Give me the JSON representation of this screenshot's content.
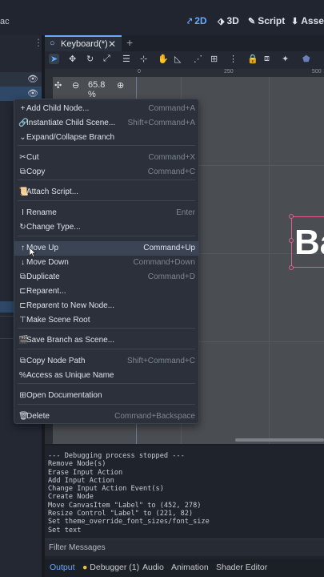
{
  "topbar": {
    "app_fragment": "ac",
    "workspaces": [
      {
        "icon": "2d-icon",
        "label": "2D",
        "active": true
      },
      {
        "icon": "3d-icon",
        "label": "3D",
        "active": false
      },
      {
        "icon": "script-icon",
        "label": "Script",
        "active": false
      },
      {
        "icon": "asset-icon",
        "label": "Asset",
        "active": false
      }
    ]
  },
  "editor": {
    "tab_label": "Keyboard(*)",
    "zoom": "65.8 %",
    "ruler_numbers": [
      "0",
      "250",
      "500"
    ]
  },
  "canvas": {
    "label_text": "Ba"
  },
  "context_menu": {
    "items": [
      {
        "icon": "add-child-icon",
        "glyph": "+",
        "label": "Add Child Node...",
        "shortcut": "Command+A"
      },
      {
        "icon": "link-icon",
        "glyph": "🔗",
        "label": "Instantiate Child Scene...",
        "shortcut": "Shift+Command+A"
      },
      {
        "icon": "chevron-down-icon",
        "glyph": "⌄",
        "label": "Expand/Collapse Branch",
        "shortcut": ""
      },
      {
        "icon": "scissors-icon",
        "glyph": "✂",
        "label": "Cut",
        "shortcut": "Command+X"
      },
      {
        "icon": "copy-icon",
        "glyph": "⧉",
        "label": "Copy",
        "shortcut": "Command+C"
      },
      {
        "icon": "script-add-icon",
        "glyph": "📜",
        "label": "Attach Script...",
        "shortcut": ""
      },
      {
        "icon": "rename-icon",
        "glyph": "I",
        "label": "Rename",
        "shortcut": "Enter"
      },
      {
        "icon": "change-type-icon",
        "glyph": "↻",
        "label": "Change Type...",
        "shortcut": ""
      },
      {
        "icon": "arrow-up-icon",
        "glyph": "↑",
        "label": "Move Up",
        "shortcut": "Command+Up"
      },
      {
        "icon": "arrow-down-icon",
        "glyph": "↓",
        "label": "Move Down",
        "shortcut": "Command+Down"
      },
      {
        "icon": "duplicate-icon",
        "glyph": "⧉",
        "label": "Duplicate",
        "shortcut": "Command+D"
      },
      {
        "icon": "reparent-icon",
        "glyph": "⊏",
        "label": "Reparent...",
        "shortcut": ""
      },
      {
        "icon": "reparent-new-icon",
        "glyph": "⊏",
        "label": "Reparent to New Node...",
        "shortcut": ""
      },
      {
        "icon": "make-root-icon",
        "glyph": "⊤",
        "label": "Make Scene Root",
        "shortcut": ""
      },
      {
        "icon": "save-branch-icon",
        "glyph": "🎬",
        "label": "Save Branch as Scene...",
        "shortcut": ""
      },
      {
        "icon": "copy-path-icon",
        "glyph": "⧉",
        "label": "Copy Node Path",
        "shortcut": "Shift+Command+C"
      },
      {
        "icon": "percent-icon",
        "glyph": "%",
        "label": "Access as Unique Name",
        "shortcut": ""
      },
      {
        "icon": "help-icon",
        "glyph": "⊞",
        "label": "Open Documentation",
        "shortcut": ""
      },
      {
        "icon": "trash-icon",
        "glyph": "🗑",
        "label": "Delete",
        "shortcut": "Command+Backspace"
      }
    ]
  },
  "output": {
    "lines": [
      "--- Debugging process stopped ---",
      "Remove Node(s)",
      "Erase Input Action",
      "Add Input Action",
      "Change Input Action Event(s)",
      "Create Node",
      "Move CanvasItem \"Label\" to (452, 278)",
      "Resize Control \"Label\" to (221, 82)",
      "Set theme_override_font_sizes/font_size",
      "Set text"
    ],
    "filter_placeholder": "Filter Messages"
  },
  "bottom_tabs": [
    {
      "label": "Output",
      "active": true
    },
    {
      "label": "Debugger (1)",
      "active": false
    },
    {
      "label": "Audio",
      "active": false
    },
    {
      "label": "Animation",
      "active": false
    },
    {
      "label": "Shader Editor",
      "active": false
    }
  ],
  "colors": {
    "accent": "#6aa8ff",
    "selection": "#e0608a",
    "debugger_dot": "#f0c040"
  }
}
